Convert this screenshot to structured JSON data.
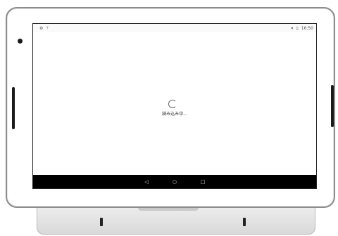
{
  "status_bar": {
    "left_icons": [
      "settings-icon",
      "network-icon"
    ],
    "left_glyphs": [
      "⚙",
      "ᛘ"
    ],
    "wifi_glyph": "▾",
    "battery_glyph": "▯",
    "time": "16:50"
  },
  "screen": {
    "loading_text": "読み込み中..."
  },
  "nav_bar": {
    "back_glyph": "◁",
    "home_glyph": "○",
    "recents_glyph": "□"
  }
}
